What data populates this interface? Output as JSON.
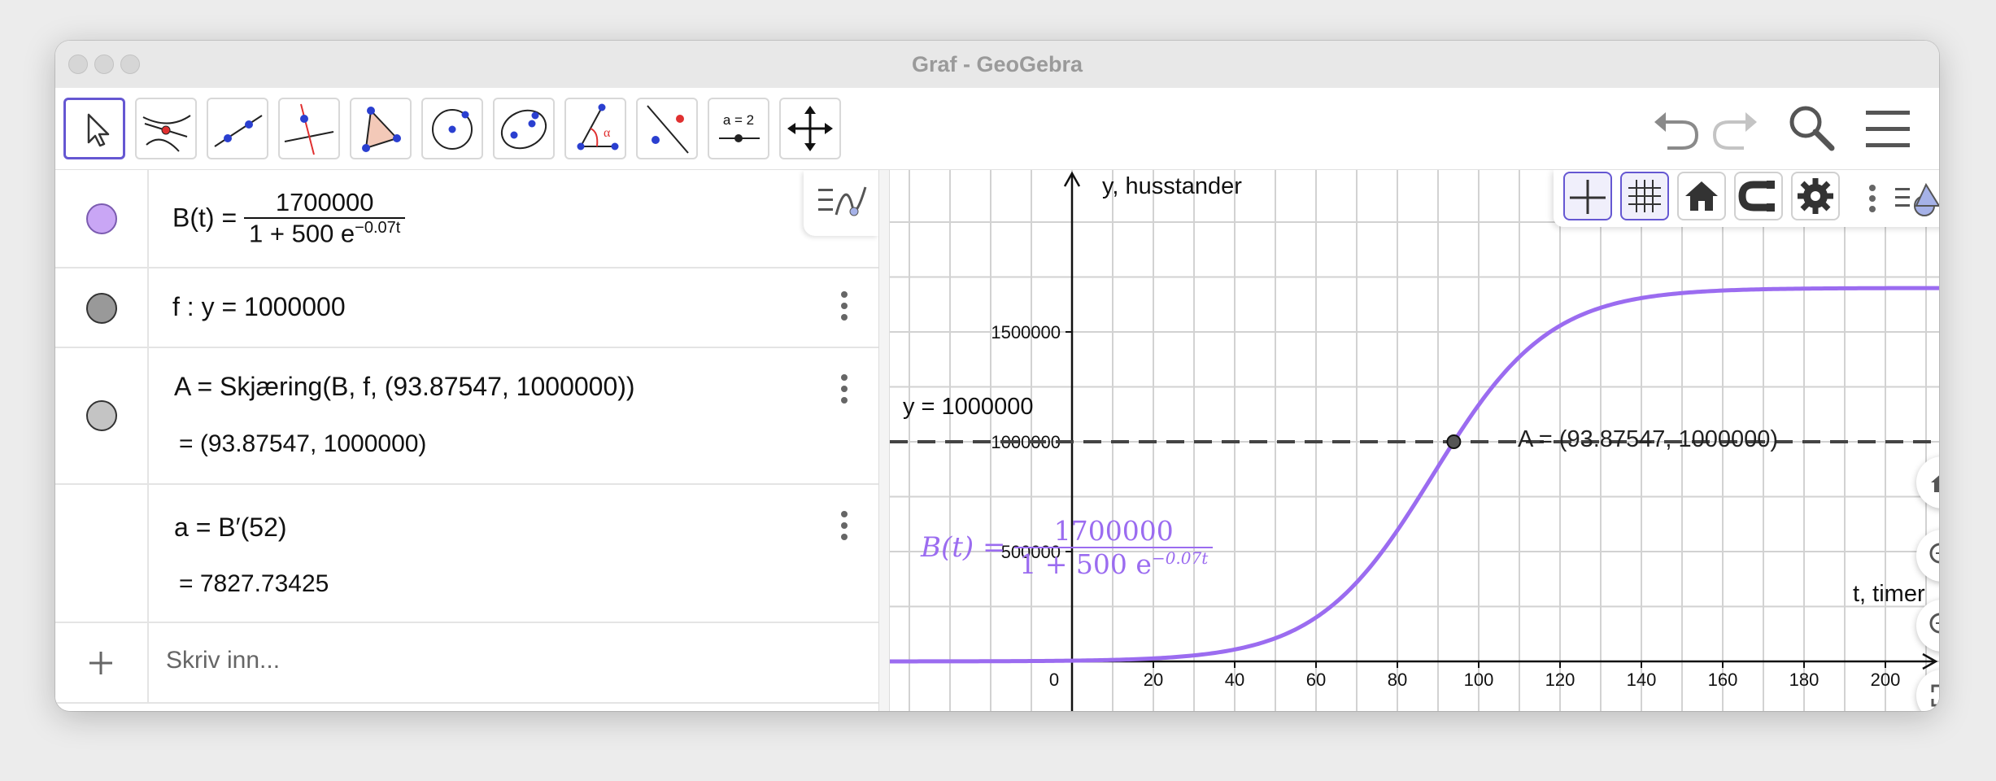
{
  "window": {
    "title": "Graf - GeoGebra"
  },
  "toolbar": {
    "tools": [
      {
        "name": "move-tool",
        "label": ""
      },
      {
        "name": "point-tool",
        "label": ""
      },
      {
        "name": "line-tool",
        "label": ""
      },
      {
        "name": "perpendicular-line-tool",
        "label": ""
      },
      {
        "name": "polygon-tool",
        "label": ""
      },
      {
        "name": "circle-tool",
        "label": ""
      },
      {
        "name": "conic-tool",
        "label": ""
      },
      {
        "name": "angle-tool",
        "label": ""
      },
      {
        "name": "reflect-tool",
        "label": ""
      },
      {
        "name": "slider-tool",
        "label": "a = 2"
      },
      {
        "name": "move-view-tool",
        "label": ""
      }
    ],
    "right_icons": [
      "undo-icon",
      "redo-icon",
      "search-icon",
      "menu-icon"
    ]
  },
  "algebra": {
    "input_placeholder": "Skriv inn...",
    "rows": [
      {
        "color": "#c9a6f5",
        "lhs": "B(t) =",
        "numerator": "1700000",
        "denominator": "1 + 500 e",
        "exponent": "−0.07t"
      },
      {
        "color": "#999999",
        "text": "f : y = 1000000"
      },
      {
        "color": "#c4c4c4",
        "text": "A = Skjæring(B, f, (93.87547, 1000000))",
        "result": "= (93.87547, 1000000)"
      },
      {
        "color": "",
        "text": "a = B′(52)",
        "result": "= 7827.73425"
      }
    ]
  },
  "graphics": {
    "axis_labels": {
      "x": "t, timer",
      "y": "y, husstander"
    },
    "x_ticks": [
      "0",
      "20",
      "40",
      "60",
      "80",
      "100",
      "120",
      "140",
      "160",
      "180",
      "200"
    ],
    "y_ticks": [
      "500000",
      "1000000",
      "1500000"
    ],
    "line_label": "y = 1000000",
    "point_label": "A = (93.87547, 1000000)",
    "curve_label": {
      "lhs": "B(t) =",
      "numerator": "1700000",
      "denominator": "1 + 500 e",
      "exponent": "−0.07t"
    },
    "colors": {
      "curve": "#9b6cf0",
      "line": "#444444",
      "point": "#555555"
    },
    "style_bar_icons": [
      "axes-icon",
      "grid-icon",
      "home-icon",
      "magnet-icon",
      "settings-icon",
      "more-icon",
      "graphics-menu-icon"
    ],
    "zoom_icons": [
      "home-icon",
      "zoom-in-icon",
      "zoom-out-icon",
      "fullscreen-icon"
    ]
  },
  "chart_data": {
    "type": "line",
    "title": "",
    "xlabel": "t, timer",
    "ylabel": "y, husstander",
    "xlim": [
      0,
      206
    ],
    "ylim": [
      -240000,
      1960000
    ],
    "x_ticks": [
      0,
      20,
      40,
      60,
      80,
      100,
      120,
      140,
      160,
      180,
      200
    ],
    "y_ticks": [
      500000,
      1000000,
      1500000
    ],
    "grid": true,
    "series": [
      {
        "formula": "1700000 / (1 + 500 e^(-0.07t))",
        "K": 1700000,
        "a": 500,
        "k": 0.07,
        "color": "#9b6cf0"
      }
    ],
    "horizontal_line": {
      "y": 1000000,
      "style": "dashed"
    },
    "points": [
      {
        "name": "A",
        "x": 93.87547,
        "y": 1000000
      }
    ]
  }
}
